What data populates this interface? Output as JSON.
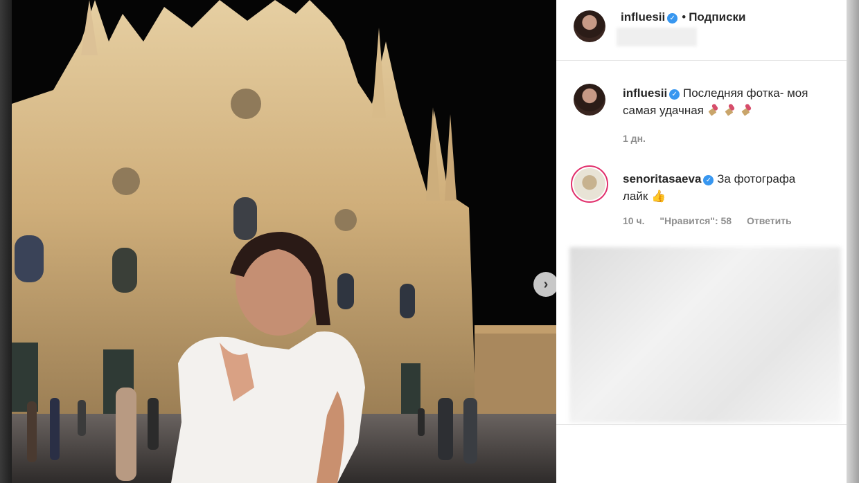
{
  "header": {
    "username": "influesii",
    "separator": "•",
    "follow_label": "Подписки"
  },
  "caption": {
    "username": "influesii",
    "text_line1": "Последняя фотка- моя",
    "text_line2": "самая удачная",
    "time": "1 дн."
  },
  "comment": {
    "username": "senoritasaeva",
    "text_line1": "За фотографа",
    "text_line2": "лайк",
    "emoji": "👍",
    "time": "10 ч.",
    "likes": "\"Нравится\": 58",
    "reply_label": "Ответить"
  },
  "colors": {
    "verified": "#3897f0",
    "story_ring": "#e1306c"
  },
  "icons": {
    "next": "chevron-right-icon",
    "verified": "verified-badge-icon"
  }
}
